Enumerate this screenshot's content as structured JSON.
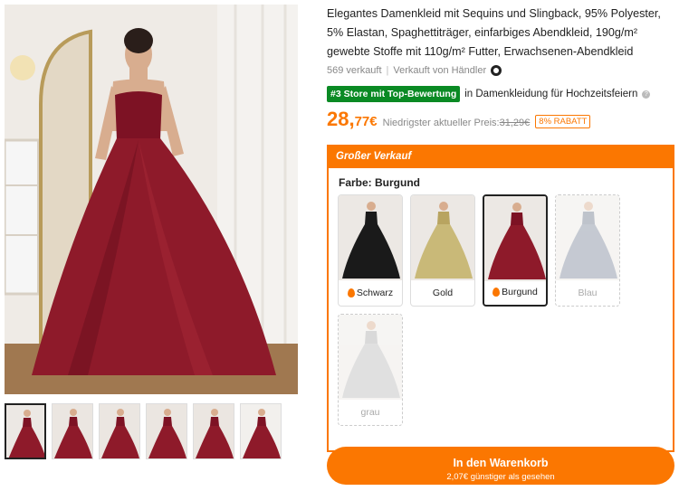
{
  "product": {
    "title": "Elegantes Damenkleid mit Sequins und Slingback, 95% Polyester, 5% Elastan, Spaghettiträger, einfarbiges Abendkleid, 190g/m² gewebte Stoffe mit 110g/m² Futter, Erwachsenen-Abendkleid",
    "sold": "569 verkauft",
    "seller": "Verkauft von Händler",
    "seller_icon": "seller-badge-icon"
  },
  "rank": {
    "badge": "#3 Store mit Top-Bewertung",
    "category": "in Damenkleidung für Hochzeitsfeiern",
    "badge_color": "#0a8a24"
  },
  "price": {
    "main": "28,",
    "cents": "77€",
    "label": "Niedrigster aktueller Preis:",
    "old": "31,29€",
    "discount": "8% RABATT",
    "accent": "#fb7701"
  },
  "sale": {
    "header": "Großer Verkauf",
    "color_label": "Farbe: Burgund"
  },
  "colors": [
    {
      "label": "Schwarz",
      "hot": true,
      "selected": false,
      "available": true,
      "hex": "#1a1a1a"
    },
    {
      "label": "Gold",
      "hot": false,
      "selected": false,
      "available": true,
      "hex": "#c9b978"
    },
    {
      "label": "Burgund",
      "hot": true,
      "selected": true,
      "available": true,
      "hex": "#8e1a2a"
    },
    {
      "label": "Blau",
      "hot": false,
      "selected": false,
      "available": false,
      "hex": "#7f8a9c"
    },
    {
      "label": "grau",
      "hot": false,
      "selected": false,
      "available": false,
      "hex": "#bcbcbc"
    }
  ],
  "cart": {
    "label": "In den Warenkorb",
    "sub": "2,07€ günstiger als gesehen"
  },
  "gallery": {
    "thumb_count": 6,
    "active_thumb": 0
  }
}
